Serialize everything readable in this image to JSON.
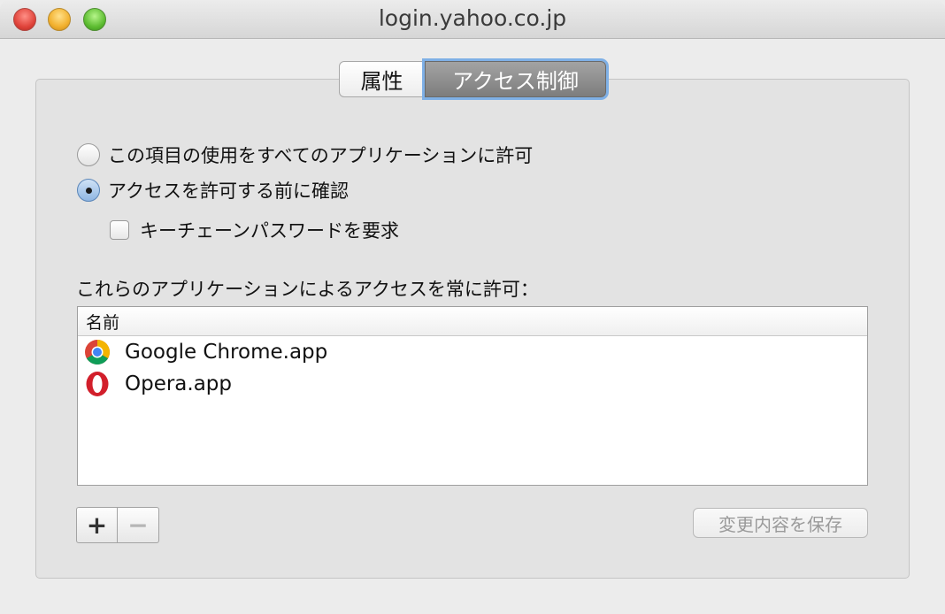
{
  "window": {
    "title": "login.yahoo.co.jp"
  },
  "tabs": [
    {
      "label": "属性",
      "selected": false
    },
    {
      "label": "アクセス制御",
      "selected": true
    }
  ],
  "options": {
    "allow_all_label": "この項目の使用をすべてのアプリケーションに許可",
    "allow_all_selected": false,
    "confirm_label": "アクセスを許可する前に確認",
    "confirm_selected": true,
    "require_password_label": "キーチェーンパスワードを要求",
    "require_password_checked": false
  },
  "app_list": {
    "label": "これらのアプリケーションによるアクセスを常に許可：",
    "column_name": "名前",
    "items": [
      {
        "name": "Google Chrome.app",
        "icon": "chrome-icon"
      },
      {
        "name": "Opera.app",
        "icon": "opera-icon"
      }
    ]
  },
  "buttons": {
    "add": "+",
    "remove": "−",
    "save": "変更内容を保存"
  }
}
